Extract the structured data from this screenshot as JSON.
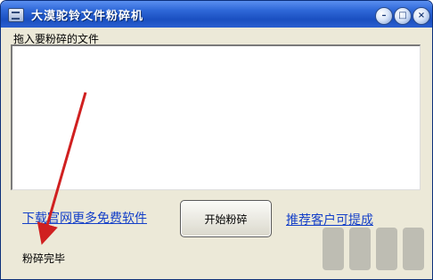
{
  "window": {
    "title": "大漠驼铃文件粉碎机",
    "controls": {
      "minimize": "–",
      "maximize": "□",
      "close": "×"
    }
  },
  "drop_area": {
    "label": "拖入要粉碎的文件"
  },
  "footer": {
    "download_link": "下载官网更多免费软件",
    "start_button": "开始粉碎",
    "recommend_link": "推荐客户可提成",
    "status": "粉碎完毕"
  },
  "colors": {
    "title_bar": "#2f68d8",
    "link": "#1540c8",
    "arrow": "#d02020"
  },
  "icons": [
    "app-icon",
    "minimize-icon",
    "maximize-icon",
    "close-icon"
  ]
}
